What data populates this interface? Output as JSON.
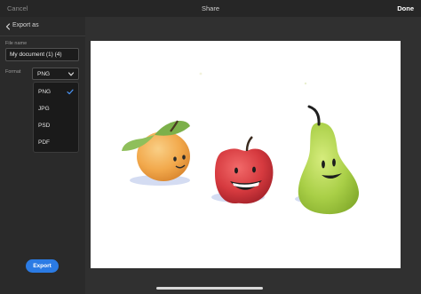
{
  "topbar": {
    "cancel": "Cancel",
    "title": "Share",
    "done": "Done"
  },
  "sidebar": {
    "back_label": "Export as",
    "file_name_label": "File name",
    "file_name_value": "My document (1) (4)",
    "format_label": "Format",
    "format_selected": "PNG",
    "format_options": [
      {
        "label": "PNG",
        "checked": true
      },
      {
        "label": "JPG",
        "checked": false
      },
      {
        "label": "PSD",
        "checked": false
      },
      {
        "label": "PDF",
        "checked": false
      }
    ],
    "export_button": "Export"
  },
  "icons": [
    "chevron-left-icon",
    "chevron-down-icon",
    "checkmark-icon"
  ],
  "colors": {
    "accent": "#2b7be4",
    "background": "#1f1f1f",
    "sidebar": "#2a2a2a",
    "canvas_bg": "#303030"
  }
}
